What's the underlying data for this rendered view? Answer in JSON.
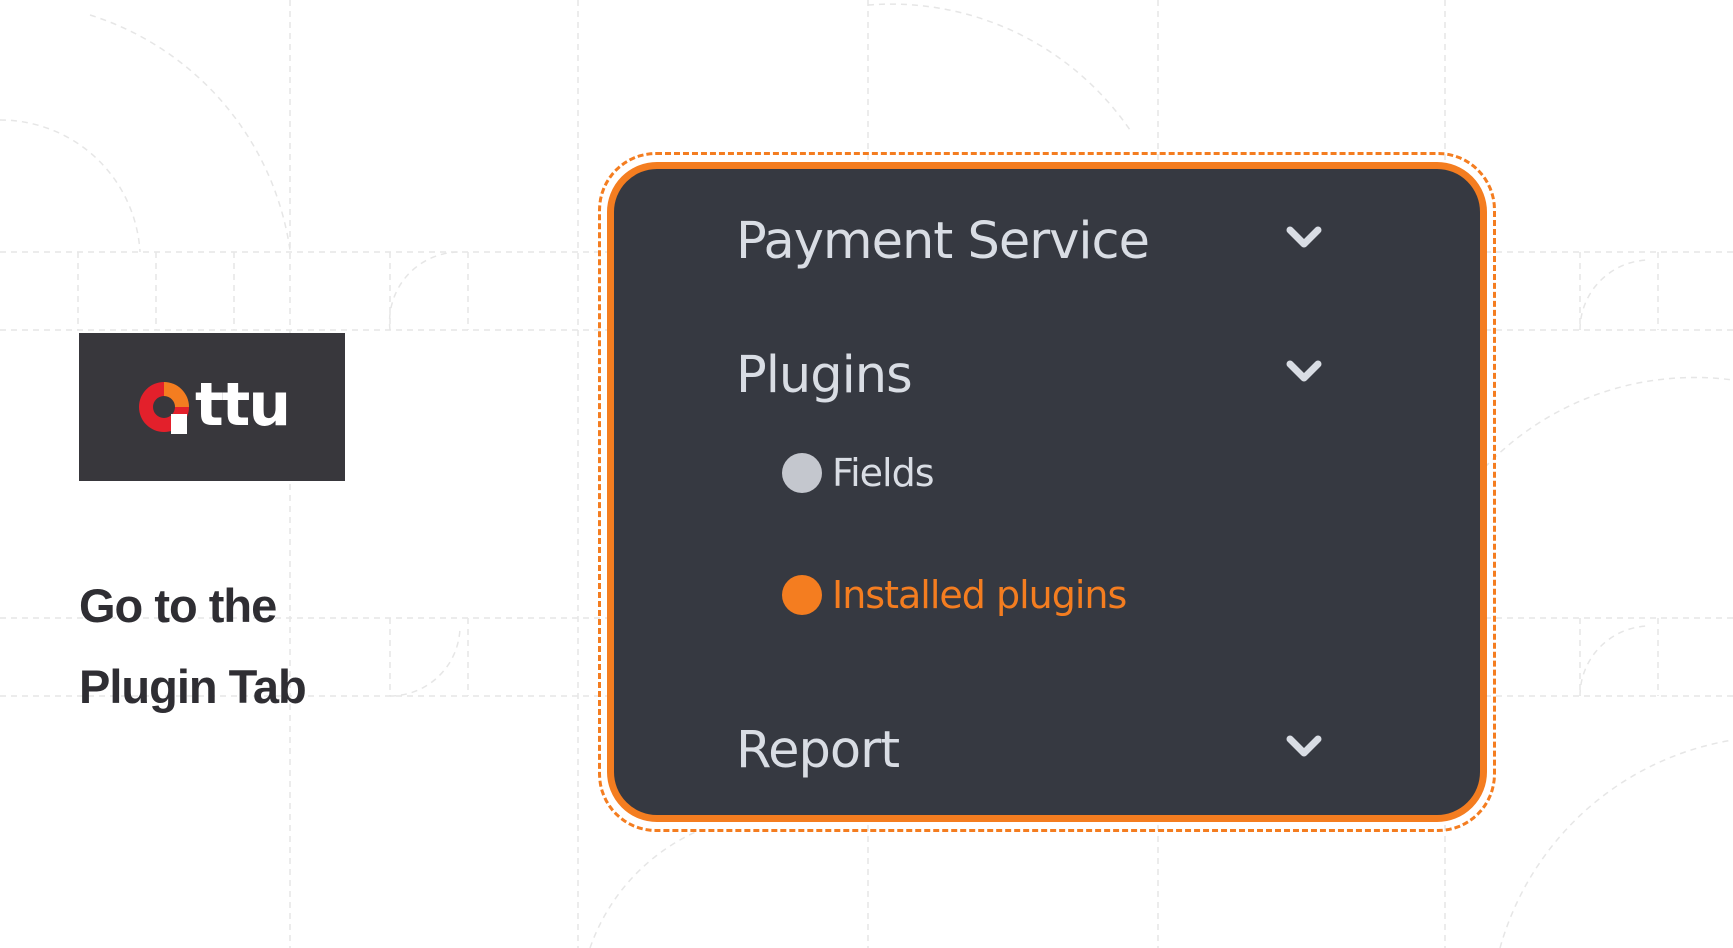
{
  "brand": {
    "logo_text": "ttu",
    "logo_full": "Ottu"
  },
  "caption": {
    "line1": "Go to the",
    "line2": "Plugin Tab"
  },
  "menu": {
    "items": [
      {
        "label": "Payment Service",
        "icon": "chevron-down-icon"
      },
      {
        "label": "Plugins",
        "icon": "chevron-down-icon"
      },
      {
        "label": "Report",
        "icon": "chevron-down-icon"
      }
    ],
    "plugins_sub": [
      {
        "label": "Fields",
        "active": false
      },
      {
        "label": "Installed plugins",
        "active": true
      }
    ]
  },
  "colors": {
    "accent": "#f47d20",
    "panel_bg": "#363941",
    "text_light": "#d9dde4",
    "inactive_dot": "#c4c7ce",
    "logo_bg": "#38373c",
    "caption_text": "#2f2e33"
  }
}
